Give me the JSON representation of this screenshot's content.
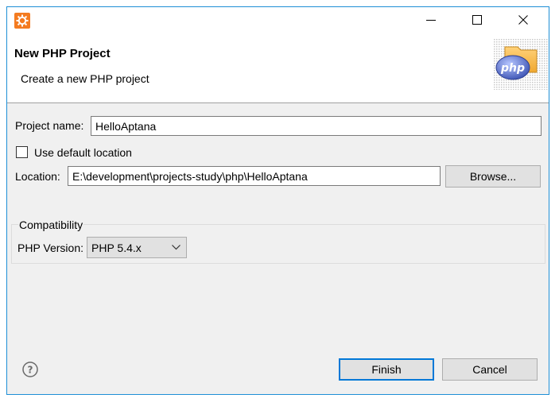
{
  "window": {
    "header_title": "New PHP Project",
    "header_description": "Create a new PHP project",
    "logo_text": "php"
  },
  "form": {
    "project_name_label": "Project name:",
    "project_name_value": "HelloAptana",
    "use_default_label": "Use default location",
    "use_default_checked": false,
    "location_label": "Location:",
    "location_value": "E:\\development\\projects-study\\php\\HelloAptana",
    "browse_label": "Browse...",
    "compatibility_label": "Compatibility",
    "php_version_label": "PHP Version:",
    "php_version_value": "PHP 5.4.x"
  },
  "footer": {
    "finish_label": "Finish",
    "cancel_label": "Cancel"
  },
  "colors": {
    "accent": "#0078d7",
    "app_icon": "#f47b20",
    "window_border": "#1e8fd6"
  },
  "icons": [
    "app-icon",
    "minimize-icon",
    "maximize-icon",
    "close-icon",
    "php-logo-icon",
    "help-icon",
    "chevron-down-icon"
  ]
}
